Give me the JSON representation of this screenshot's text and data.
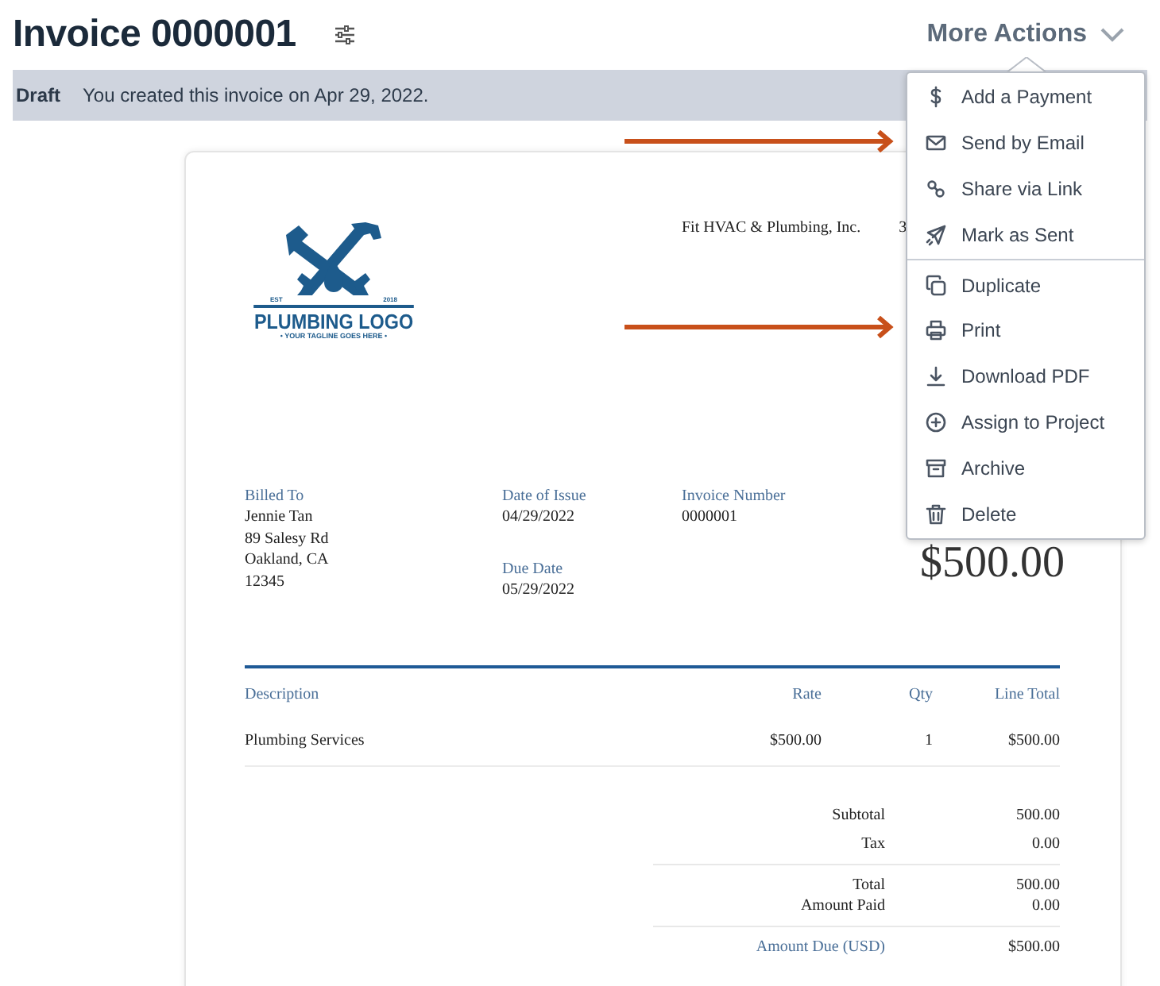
{
  "header": {
    "title": "Invoice 0000001",
    "more_actions": "More Actions"
  },
  "banner": {
    "status": "Draft",
    "message": "You created this invoice on Apr 29, 2022."
  },
  "menu": {
    "groups": [
      [
        {
          "label": "Add a Payment",
          "kind": "dollar"
        },
        {
          "label": "Send by Email",
          "kind": "email"
        },
        {
          "label": "Share via Link",
          "kind": "link"
        },
        {
          "label": "Mark as Sent",
          "kind": "sent"
        }
      ],
      [
        {
          "label": "Duplicate",
          "kind": "duplicate"
        },
        {
          "label": "Print",
          "kind": "print"
        },
        {
          "label": "Download PDF",
          "kind": "download"
        },
        {
          "label": "Assign to Project",
          "kind": "assign"
        },
        {
          "label": "Archive",
          "kind": "archive"
        },
        {
          "label": "Delete",
          "kind": "delete"
        }
      ]
    ]
  },
  "invoice": {
    "logo": {
      "est": "EST",
      "year": "2018",
      "title": "PLUMBING LOGO",
      "tagline": "• YOUR TAGLINE GOES HERE •"
    },
    "company": "Fit HVAC & Plumbing, Inc.",
    "company_address": "3",
    "billed_to": {
      "label": "Billed To",
      "lines": [
        "Jennie Tan",
        "89 Salesy Rd",
        "Oakland, CA",
        "12345"
      ]
    },
    "date_of_issue": {
      "label": "Date of Issue",
      "value": "04/29/2022"
    },
    "due_date": {
      "label": "Due Date",
      "value": "05/29/2022"
    },
    "invoice_number": {
      "label": "Invoice Number",
      "value": "0000001"
    },
    "amount_due_large": "$500.00",
    "table": {
      "columns": [
        "Description",
        "Rate",
        "Qty",
        "Line Total"
      ],
      "rows": [
        [
          "Plumbing Services",
          "$500.00",
          "1",
          "$500.00"
        ]
      ]
    },
    "totals": [
      [
        {
          "label": "Subtotal",
          "value": "500.00"
        },
        {
          "label": "Tax",
          "value": "0.00"
        }
      ],
      [
        {
          "label": "Total",
          "value": "500.00"
        },
        {
          "label": "Amount Paid",
          "value": "0.00"
        }
      ],
      [
        {
          "label": "Amount Due (USD)",
          "value": "$500.00",
          "kind": "due"
        }
      ]
    ]
  }
}
